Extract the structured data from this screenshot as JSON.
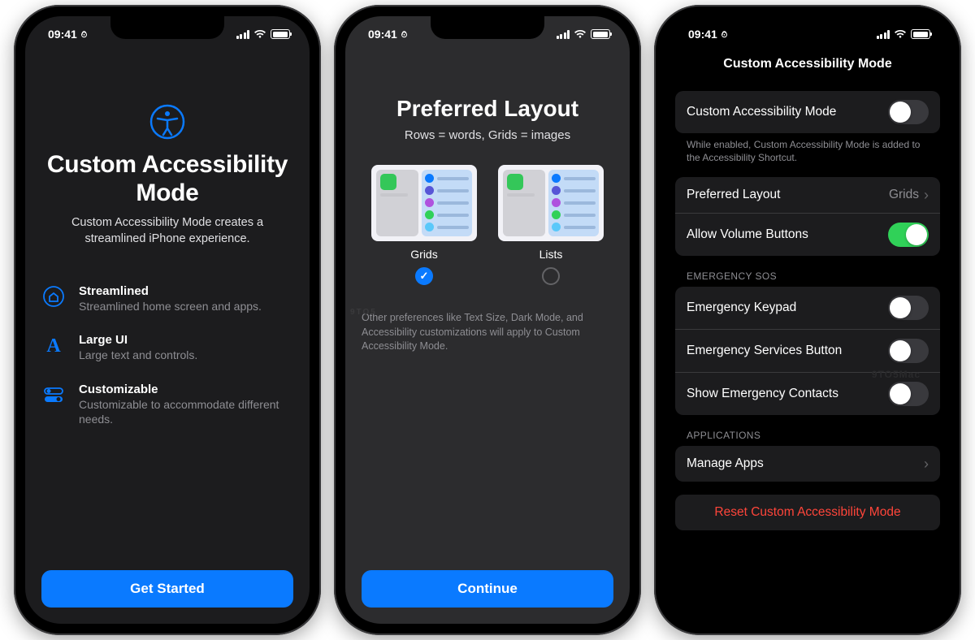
{
  "status": {
    "time": "09:41"
  },
  "screen1": {
    "title": "Custom Accessibility Mode",
    "subtitle": "Custom Accessibility Mode creates a streamlined iPhone experience.",
    "features": [
      {
        "title": "Streamlined",
        "desc": "Streamlined home screen and apps."
      },
      {
        "title": "Large UI",
        "desc": "Large text and controls."
      },
      {
        "title": "Customizable",
        "desc": "Customizable to accommodate different needs."
      }
    ],
    "cta": "Get Started"
  },
  "screen2": {
    "title": "Preferred Layout",
    "subtitle": "Rows = words, Grids = images",
    "option_grids": "Grids",
    "option_lists": "Lists",
    "note": "Other preferences like Text Size, Dark Mode, and Accessibility customizations will apply to Custom Accessibility Mode.",
    "cta": "Continue",
    "watermark": "9TO5"
  },
  "screen3": {
    "nav_title": "Custom Accessibility Mode",
    "toggle_main_label": "Custom Accessibility Mode",
    "toggle_main_footer": "While enabled, Custom Accessibility Mode is added to the Accessibility Shortcut.",
    "preferred_layout_label": "Preferred Layout",
    "preferred_layout_value": "Grids",
    "allow_volume_label": "Allow Volume Buttons",
    "sos_header": "EMERGENCY SOS",
    "sos_keypad": "Emergency Keypad",
    "sos_services": "Emergency Services Button",
    "sos_contacts": "Show Emergency Contacts",
    "apps_header": "APPLICATIONS",
    "manage_apps": "Manage Apps",
    "reset": "Reset Custom Accessibility Mode",
    "watermark": "9TO5Mac"
  }
}
